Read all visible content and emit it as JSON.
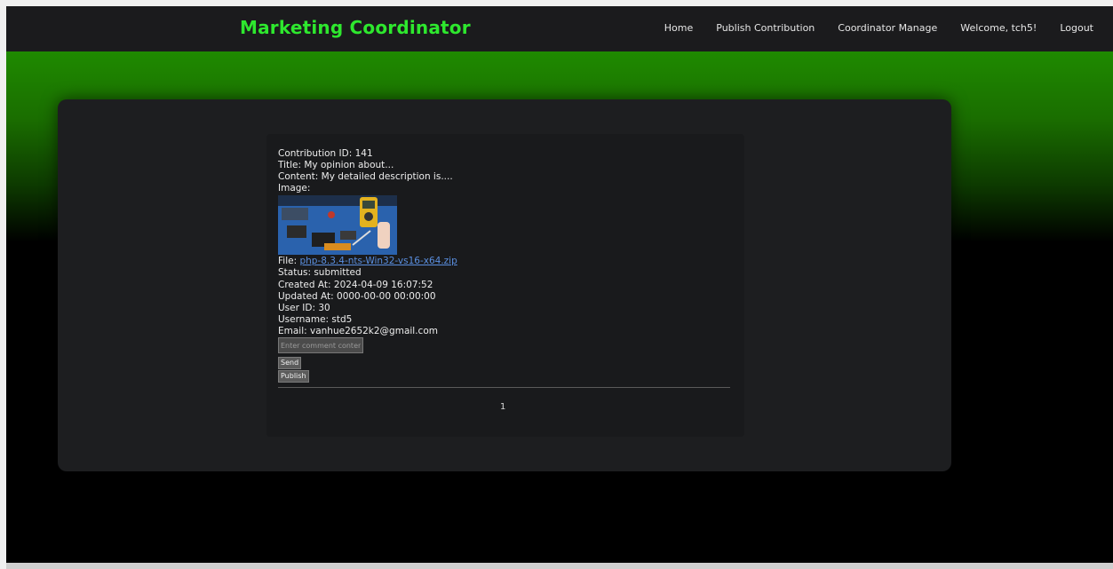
{
  "navbar": {
    "brand": "Marketing Coordinator",
    "links": [
      "Home",
      "Publish Contribution",
      "Coordinator Manage",
      "Welcome, tch5!",
      "Logout"
    ]
  },
  "contribution": {
    "id_line": "Contribution ID: 141",
    "title_line": "Title: My opinion about...",
    "content_line": "Content: My detailed description is....",
    "image_label": "Image:",
    "file_label": "File: ",
    "file_name": "php-8.3.4-nts-Win32-vs16-x64.zip",
    "status_line": "Status: submitted",
    "created_line": "Created At: 2024-04-09 16:07:52",
    "updated_line": "Updated At: 0000-00-00 00:00:00",
    "user_id_line": "User ID: 30",
    "username_line": "Username: std5",
    "email_line": "Email: vanhue2652k2@gmail.com"
  },
  "comment": {
    "placeholder": "Enter comment content",
    "send_label": "Send",
    "publish_label": "Publish"
  },
  "pagination": {
    "current_page": "1"
  },
  "colors": {
    "brand": "#2ee82e",
    "gradient_top": "#1f8a00",
    "link": "#5a8fe0"
  }
}
